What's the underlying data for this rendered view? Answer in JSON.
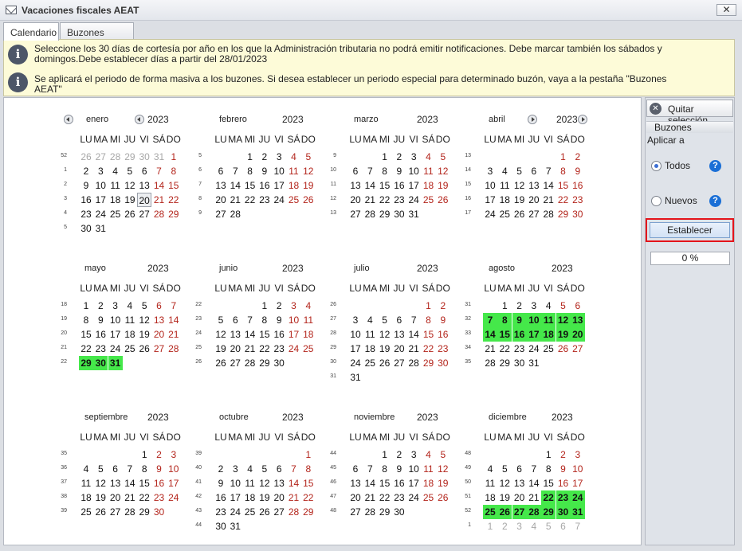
{
  "window": {
    "title": "Vacaciones fiscales AEAT",
    "close_label": "✕"
  },
  "tabs": [
    {
      "label": "Calendario",
      "active": true
    },
    {
      "label": "Buzones AEAT",
      "active": false
    }
  ],
  "info": {
    "line1": "Seleccione los 30 días  de cortesía por año en los que la Administración tributaria no podrá emitir notificaciones. Debe marcar también los sábados y domingos.Debe establecer días a partir del 28/01/2023",
    "line2": "Se aplicará el periodo de forma masiva a los buzones. Si desea establecer un periodo especial para determinado buzón, vaya a la pestaña \"Buzones AEAT\"",
    "icon": "info-icon"
  },
  "weekday_headers": [
    "LU",
    "MA",
    "MI",
    "JU",
    "VI",
    "SÁ",
    "DO"
  ],
  "colors": {
    "weekend": "#b3241b",
    "selected": "#45e84a",
    "highlight_border": "#e4141a"
  },
  "today": {
    "month": 0,
    "day": 20
  },
  "months": [
    {
      "name": "enero",
      "year": "2023",
      "weeks": [
        "52",
        "1",
        "2",
        "3",
        "4",
        "5"
      ],
      "days": [
        [
          26,
          27,
          28,
          29,
          30,
          31,
          1
        ],
        [
          2,
          3,
          4,
          5,
          6,
          7,
          8
        ],
        [
          9,
          10,
          11,
          12,
          13,
          14,
          15
        ],
        [
          16,
          17,
          18,
          19,
          20,
          21,
          22
        ],
        [
          23,
          24,
          25,
          26,
          27,
          28,
          29
        ],
        [
          30,
          31,
          null,
          null,
          null,
          null,
          null
        ]
      ],
      "first_row_prev": true,
      "selected": []
    },
    {
      "name": "febrero",
      "year": "2023",
      "weeks": [
        "5",
        "6",
        "7",
        "8",
        "9"
      ],
      "days": [
        [
          null,
          null,
          1,
          2,
          3,
          4,
          5
        ],
        [
          6,
          7,
          8,
          9,
          10,
          11,
          12
        ],
        [
          13,
          14,
          15,
          16,
          17,
          18,
          19
        ],
        [
          20,
          21,
          22,
          23,
          24,
          25,
          26
        ],
        [
          27,
          28,
          null,
          null,
          null,
          null,
          null
        ]
      ],
      "selected": []
    },
    {
      "name": "marzo",
      "year": "2023",
      "weeks": [
        "9",
        "10",
        "11",
        "12",
        "13"
      ],
      "days": [
        [
          null,
          null,
          1,
          2,
          3,
          4,
          5
        ],
        [
          6,
          7,
          8,
          9,
          10,
          11,
          12
        ],
        [
          13,
          14,
          15,
          16,
          17,
          18,
          19
        ],
        [
          20,
          21,
          22,
          23,
          24,
          25,
          26
        ],
        [
          27,
          28,
          29,
          30,
          31,
          null,
          null
        ]
      ],
      "selected": []
    },
    {
      "name": "abril",
      "year": "2023",
      "weeks": [
        "13",
        "14",
        "15",
        "16",
        "17"
      ],
      "days": [
        [
          null,
          null,
          null,
          null,
          null,
          1,
          2
        ],
        [
          3,
          4,
          5,
          6,
          7,
          8,
          9
        ],
        [
          10,
          11,
          12,
          13,
          14,
          15,
          16
        ],
        [
          17,
          18,
          19,
          20,
          21,
          22,
          23
        ],
        [
          24,
          25,
          26,
          27,
          28,
          29,
          30
        ]
      ],
      "selected": []
    },
    {
      "name": "mayo",
      "year": "2023",
      "weeks": [
        "18",
        "19",
        "20",
        "21",
        "22"
      ],
      "days": [
        [
          1,
          2,
          3,
          4,
          5,
          6,
          7
        ],
        [
          8,
          9,
          10,
          11,
          12,
          13,
          14
        ],
        [
          15,
          16,
          17,
          18,
          19,
          20,
          21
        ],
        [
          22,
          23,
          24,
          25,
          26,
          27,
          28
        ],
        [
          29,
          30,
          31,
          null,
          null,
          null,
          null
        ]
      ],
      "selected": [
        29,
        30,
        31
      ]
    },
    {
      "name": "junio",
      "year": "2023",
      "weeks": [
        "22",
        "23",
        "24",
        "25",
        "26"
      ],
      "days": [
        [
          null,
          null,
          null,
          1,
          2,
          3,
          4
        ],
        [
          5,
          6,
          7,
          8,
          9,
          10,
          11
        ],
        [
          12,
          13,
          14,
          15,
          16,
          17,
          18
        ],
        [
          19,
          20,
          21,
          22,
          23,
          24,
          25
        ],
        [
          26,
          27,
          28,
          29,
          30,
          null,
          null
        ]
      ],
      "selected": []
    },
    {
      "name": "julio",
      "year": "2023",
      "weeks": [
        "26",
        "27",
        "28",
        "29",
        "30",
        "31"
      ],
      "days": [
        [
          null,
          null,
          null,
          null,
          null,
          1,
          2
        ],
        [
          3,
          4,
          5,
          6,
          7,
          8,
          9
        ],
        [
          10,
          11,
          12,
          13,
          14,
          15,
          16
        ],
        [
          17,
          18,
          19,
          20,
          21,
          22,
          23
        ],
        [
          24,
          25,
          26,
          27,
          28,
          29,
          30
        ],
        [
          31,
          null,
          null,
          null,
          null,
          null,
          null
        ]
      ],
      "selected": []
    },
    {
      "name": "agosto",
      "year": "2023",
      "weeks": [
        "31",
        "32",
        "33",
        "34",
        "35"
      ],
      "days": [
        [
          null,
          1,
          2,
          3,
          4,
          5,
          6
        ],
        [
          7,
          8,
          9,
          10,
          11,
          12,
          13
        ],
        [
          14,
          15,
          16,
          17,
          18,
          19,
          20
        ],
        [
          21,
          22,
          23,
          24,
          25,
          26,
          27
        ],
        [
          28,
          29,
          30,
          31,
          null,
          null,
          null
        ]
      ],
      "selected": [
        7,
        8,
        9,
        10,
        11,
        12,
        13,
        14,
        15,
        16,
        17,
        18,
        19,
        20
      ]
    },
    {
      "name": "septiembre",
      "year": "2023",
      "weeks": [
        "35",
        "36",
        "37",
        "38",
        "39"
      ],
      "days": [
        [
          null,
          null,
          null,
          null,
          1,
          2,
          3
        ],
        [
          4,
          5,
          6,
          7,
          8,
          9,
          10
        ],
        [
          11,
          12,
          13,
          14,
          15,
          16,
          17
        ],
        [
          18,
          19,
          20,
          21,
          22,
          23,
          24
        ],
        [
          25,
          26,
          27,
          28,
          29,
          30,
          null
        ]
      ],
      "selected": []
    },
    {
      "name": "octubre",
      "year": "2023",
      "weeks": [
        "39",
        "40",
        "41",
        "42",
        "43",
        "44"
      ],
      "days": [
        [
          null,
          null,
          null,
          null,
          null,
          null,
          1
        ],
        [
          2,
          3,
          4,
          5,
          6,
          7,
          8
        ],
        [
          9,
          10,
          11,
          12,
          13,
          14,
          15
        ],
        [
          16,
          17,
          18,
          19,
          20,
          21,
          22
        ],
        [
          23,
          24,
          25,
          26,
          27,
          28,
          29
        ],
        [
          30,
          31,
          null,
          null,
          null,
          null,
          null
        ]
      ],
      "selected": []
    },
    {
      "name": "noviembre",
      "year": "2023",
      "weeks": [
        "44",
        "45",
        "46",
        "47",
        "48"
      ],
      "days": [
        [
          null,
          null,
          1,
          2,
          3,
          4,
          5
        ],
        [
          6,
          7,
          8,
          9,
          10,
          11,
          12
        ],
        [
          13,
          14,
          15,
          16,
          17,
          18,
          19
        ],
        [
          20,
          21,
          22,
          23,
          24,
          25,
          26
        ],
        [
          27,
          28,
          29,
          30,
          null,
          null,
          null
        ]
      ],
      "selected": []
    },
    {
      "name": "diciembre",
      "year": "2023",
      "weeks": [
        "48",
        "49",
        "50",
        "51",
        "52",
        "1"
      ],
      "days": [
        [
          null,
          null,
          null,
          null,
          1,
          2,
          3
        ],
        [
          4,
          5,
          6,
          7,
          8,
          9,
          10
        ],
        [
          11,
          12,
          13,
          14,
          15,
          16,
          17
        ],
        [
          18,
          19,
          20,
          21,
          22,
          23,
          24
        ],
        [
          25,
          26,
          27,
          28,
          29,
          30,
          31
        ],
        [
          1,
          2,
          3,
          4,
          5,
          6,
          7
        ]
      ],
      "last_row_next": true,
      "selected": [
        22,
        23,
        24,
        25,
        26,
        27,
        28,
        29,
        30,
        31
      ]
    }
  ],
  "side": {
    "quitar_label": "Quitar selección",
    "buzones_header": "Buzones",
    "aplicar_label": "Aplicar a",
    "todos_label": "Todos",
    "nuevos_label": "Nuevos",
    "todos_checked": true,
    "establecer_label": "Establecer",
    "progress_text": "0 %"
  }
}
